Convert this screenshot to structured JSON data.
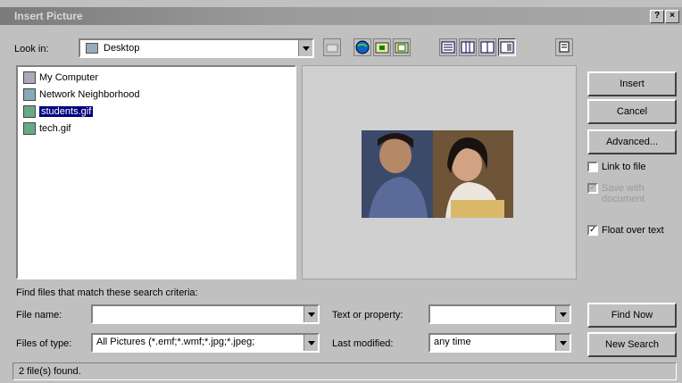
{
  "window": {
    "title": "Insert Picture",
    "help_button": "?",
    "close_button": "×"
  },
  "look_in": {
    "label": "Look in:",
    "value": "Desktop"
  },
  "files": [
    {
      "name": "My Computer",
      "icon": "computer-icon",
      "selected": false
    },
    {
      "name": "Network Neighborhood",
      "icon": "network-icon",
      "selected": false
    },
    {
      "name": "students.gif",
      "icon": "image-file-icon",
      "selected": true
    },
    {
      "name": "tech.gif",
      "icon": "image-file-icon",
      "selected": false
    }
  ],
  "buttons": {
    "insert": "Insert",
    "cancel": "Cancel",
    "advanced": "Advanced...",
    "find_now": "Find Now",
    "new_search": "New Search"
  },
  "options": {
    "link_to_file": {
      "label": "Link to file",
      "checked": false
    },
    "save_with_document": {
      "label": "Save with document",
      "checked": true,
      "disabled": true
    },
    "float_over_text": {
      "label": "Float over text",
      "checked": true
    }
  },
  "search": {
    "criteria_label": "Find files that match these search criteria:",
    "file_name_label": "File name:",
    "file_name_value": "",
    "files_of_type_label": "Files of type:",
    "files_of_type_value": "All Pictures (*.emf;*.wmf;*.jpg;*.jpeg;",
    "text_property_label": "Text or property:",
    "text_property_value": "",
    "last_modified_label": "Last modified:",
    "last_modified_value": "any time"
  },
  "status": {
    "text": "2 file(s) found."
  }
}
